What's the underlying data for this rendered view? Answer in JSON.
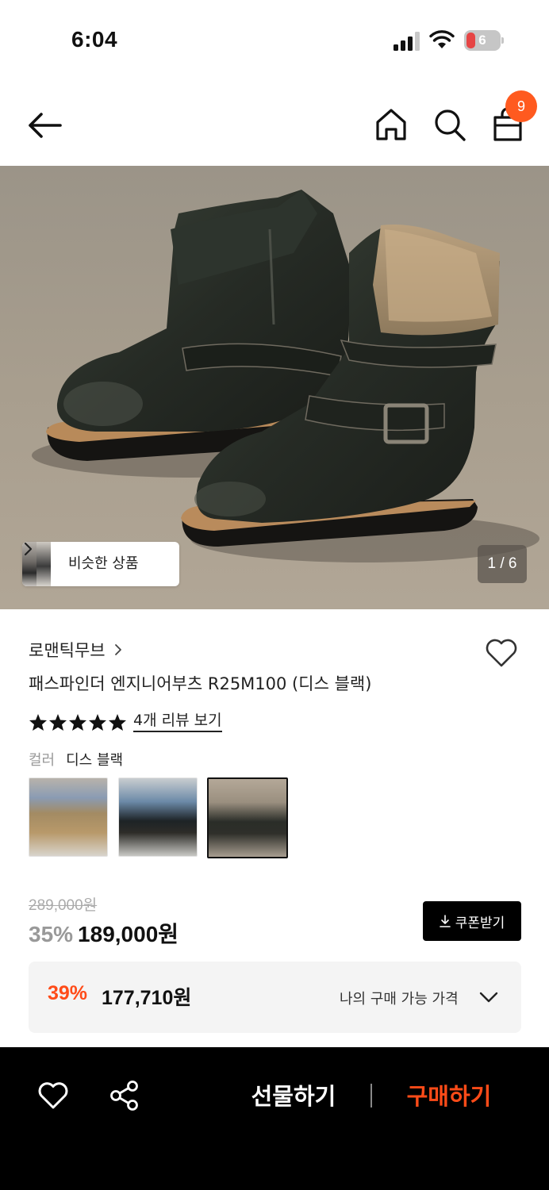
{
  "status_bar": {
    "time": "6:04",
    "battery": "6"
  },
  "nav": {
    "cart_count": "9"
  },
  "hero": {
    "similar_label": "비슷한 상품",
    "page_counter": "1 / 6"
  },
  "product": {
    "brand": "로맨틱무브",
    "title": "패스파인더 엔지니어부츠 R25M100 (디스 블랙)",
    "rating_stars": 5,
    "review_link": "4개 리뷰 보기",
    "color_key": "컬러",
    "color_value": "디스 블랙"
  },
  "price": {
    "original": "289,000원",
    "discount": "35%",
    "sale": "189,000원",
    "coupon_label": "쿠폰받기"
  },
  "my_price": {
    "discount": "39%",
    "price": "177,710원",
    "label": "나의 구매 가능 가격"
  },
  "bottom_bar": {
    "gift_label": "선물하기",
    "buy_label": "구매하기"
  },
  "colors": {
    "accent": "#ff4b18",
    "badge": "#ff5a1f",
    "black": "#000000"
  }
}
